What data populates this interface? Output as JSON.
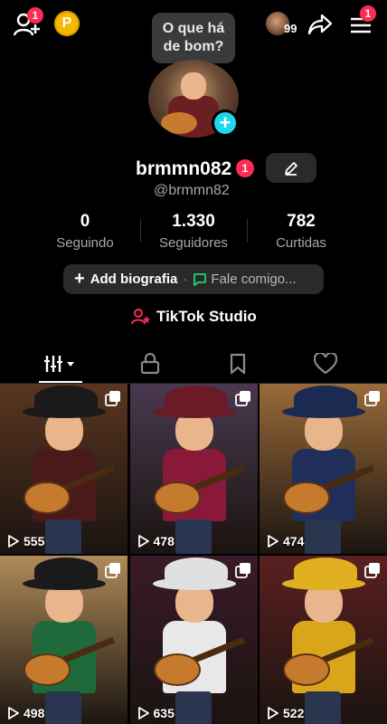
{
  "header": {
    "add_friends_badge": "1",
    "coin_label": "P",
    "viewers_count": "99",
    "menu_badge": "1"
  },
  "bubble": {
    "text_line1": "O que há",
    "text_line2": "de bom?"
  },
  "profile": {
    "username": "brmmn082",
    "username_badge": "1",
    "handle": "@brmmn82"
  },
  "stats": [
    {
      "value": "0",
      "label": "Seguindo"
    },
    {
      "value": "1.330",
      "label": "Seguidores"
    },
    {
      "value": "782",
      "label": "Curtidas"
    }
  ],
  "bio": {
    "add_label": "Add biografia",
    "separator": "·",
    "message_label": "Fale comigo..."
  },
  "studio": {
    "label": "TikTok Studio"
  },
  "tabs": [
    "videos-tab",
    "private-tab",
    "saved-tab",
    "liked-tab"
  ],
  "videos": [
    {
      "views": "555",
      "outfit": "#4a1a1a",
      "hat": "#1a1a1a",
      "bg": "#5a3520"
    },
    {
      "views": "478",
      "outfit": "#8a1838",
      "hat": "#6b1a28",
      "bg": "#4a3850"
    },
    {
      "views": "474",
      "outfit": "#1f2f5a",
      "hat": "#1a2a50",
      "bg": "#9a6a3a"
    },
    {
      "views": "498",
      "outfit": "#1f6a3a",
      "hat": "#1a1a1a",
      "bg": "#b08a5a"
    },
    {
      "views": "635",
      "outfit": "#e8e8e8",
      "hat": "#e0e0e0",
      "bg": "#3a1a28"
    },
    {
      "views": "522",
      "outfit": "#d9a51a",
      "hat": "#e0b020",
      "bg": "#5a2020"
    }
  ],
  "colors": {
    "accent": "#fe2c55",
    "cyan": "#20d5ec",
    "green": "#25d366",
    "coin": "#f5b800"
  }
}
